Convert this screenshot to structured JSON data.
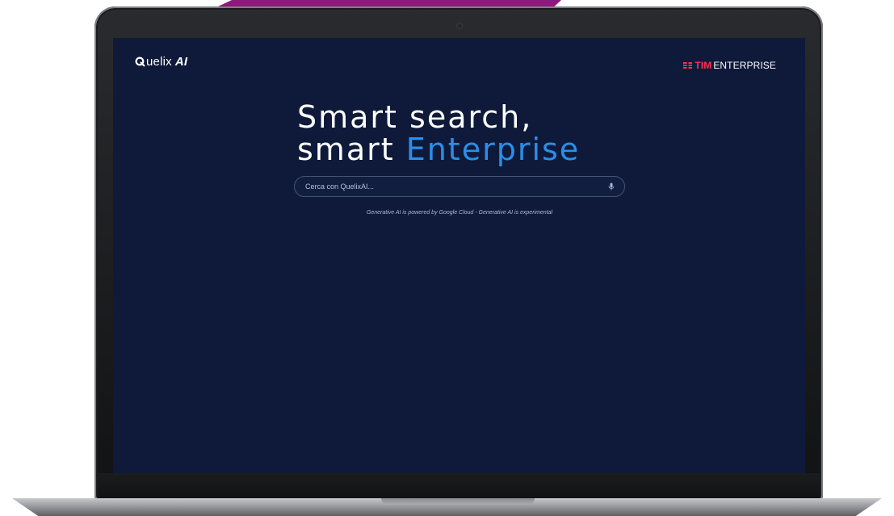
{
  "app": {
    "logo_text": "uelix",
    "logo_ai": "AI",
    "brand_tim": "TIM",
    "brand_enterprise": "ENTERPRISE"
  },
  "hero": {
    "line1": "Smart search,",
    "line2_prefix": "smart ",
    "line2_accent": "Enterprise"
  },
  "search": {
    "placeholder": "Cerca con QuelixAI...",
    "value": ""
  },
  "disclaimer": "Generative AI is powered by Google Cloud - Generative AI is experimental",
  "icons": {
    "logo": "quelix-logo-icon",
    "brand": "tim-logo-icon",
    "mic": "microphone-icon"
  },
  "colors": {
    "background": "#0f1a3a",
    "accent": "#2c8ee8",
    "tim_red": "#ff2f4f",
    "text": "#ffffff",
    "ribbon": "#8d1a7c"
  }
}
